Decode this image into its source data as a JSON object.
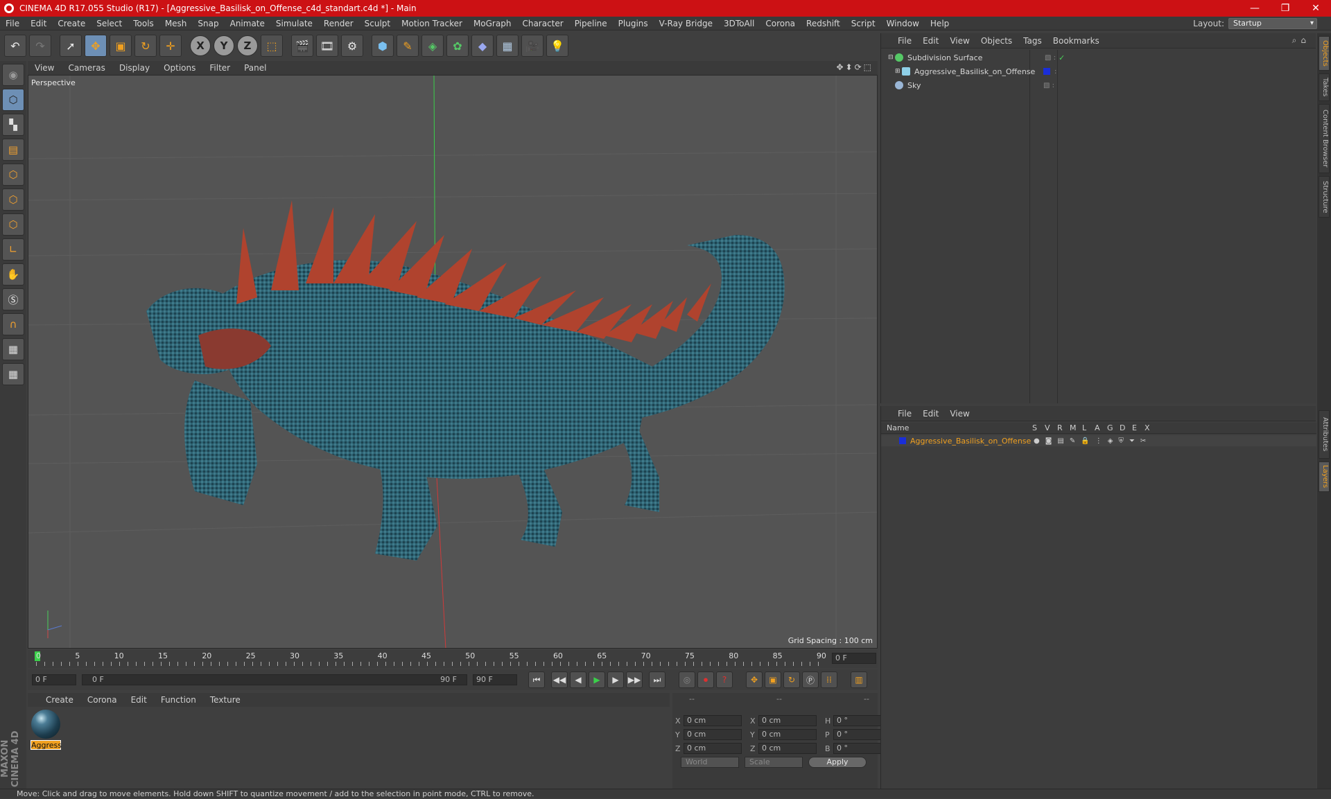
{
  "window": {
    "title": "CINEMA 4D R17.055 Studio (R17) - [Aggressive_Basilisk_on_Offense_c4d_standart.c4d *] - Main",
    "controls": [
      "—",
      "❐",
      "✕"
    ]
  },
  "menubar": [
    "File",
    "Edit",
    "Create",
    "Select",
    "Tools",
    "Mesh",
    "Snap",
    "Animate",
    "Simulate",
    "Render",
    "Sculpt",
    "Motion Tracker",
    "MoGraph",
    "Character",
    "Pipeline",
    "Plugins",
    "V-Ray Bridge",
    "3DToAll",
    "Corona",
    "Redshift",
    "Script",
    "Window",
    "Help"
  ],
  "layout": {
    "label": "Layout:",
    "value": "Startup"
  },
  "viewport": {
    "menu": [
      "View",
      "Cameras",
      "Display",
      "Options",
      "Filter",
      "Panel"
    ],
    "name": "Perspective",
    "grid_spacing": "Grid Spacing : 100 cm"
  },
  "timeline": {
    "ticks": [
      "0",
      "5",
      "10",
      "15",
      "20",
      "25",
      "30",
      "35",
      "40",
      "45",
      "50",
      "55",
      "60",
      "65",
      "70",
      "75",
      "80",
      "85",
      "90"
    ],
    "current_frame": "0 F",
    "start_field": "0 F",
    "range_start": "0 F",
    "range_end": "90 F",
    "end_field": "90 F"
  },
  "material_manager": {
    "menu": [
      "Create",
      "Corona",
      "Edit",
      "Function",
      "Texture"
    ],
    "materials": [
      {
        "label": "Aggress"
      }
    ]
  },
  "coordinates": {
    "header": [
      "--",
      "--",
      "--"
    ],
    "rows": [
      {
        "a": "X",
        "av": "0 cm",
        "b": "X",
        "bv": "0 cm",
        "c": "H",
        "cv": "0 °"
      },
      {
        "a": "Y",
        "av": "0 cm",
        "b": "Y",
        "bv": "0 cm",
        "c": "P",
        "cv": "0 °"
      },
      {
        "a": "Z",
        "av": "0 cm",
        "b": "Z",
        "bv": "0 cm",
        "c": "B",
        "cv": "0 °"
      }
    ],
    "world": "World",
    "scale": "Scale",
    "apply": "Apply"
  },
  "object_manager": {
    "menu": [
      "File",
      "Edit",
      "View",
      "Objects",
      "Tags",
      "Bookmarks"
    ],
    "objects": [
      {
        "name": "Subdivision Surface",
        "color": "#55c866"
      },
      {
        "name": "Aggressive_Basilisk_on_Offense",
        "color": "#8fd0e8"
      },
      {
        "name": "Sky",
        "color": "#9ab6d6"
      }
    ]
  },
  "layer_manager": {
    "menu": [
      "File",
      "Edit",
      "View"
    ],
    "columns": [
      "Name",
      "S",
      "V",
      "R",
      "M",
      "L",
      "A",
      "G",
      "D",
      "E",
      "X"
    ],
    "layers": [
      {
        "name": "Aggressive_Basilisk_on_Offense",
        "color": "#1a2ed8"
      }
    ]
  },
  "side_tabs": [
    "Objects",
    "Takes",
    "Content Browser",
    "Structure",
    "Attributes",
    "Layers"
  ],
  "maxon": "MAXON CINEMA 4D",
  "status": "Move: Click and drag to move elements. Hold down SHIFT to quantize movement / add to the selection in point mode, CTRL to remove.",
  "accent_color": "#f0a020"
}
